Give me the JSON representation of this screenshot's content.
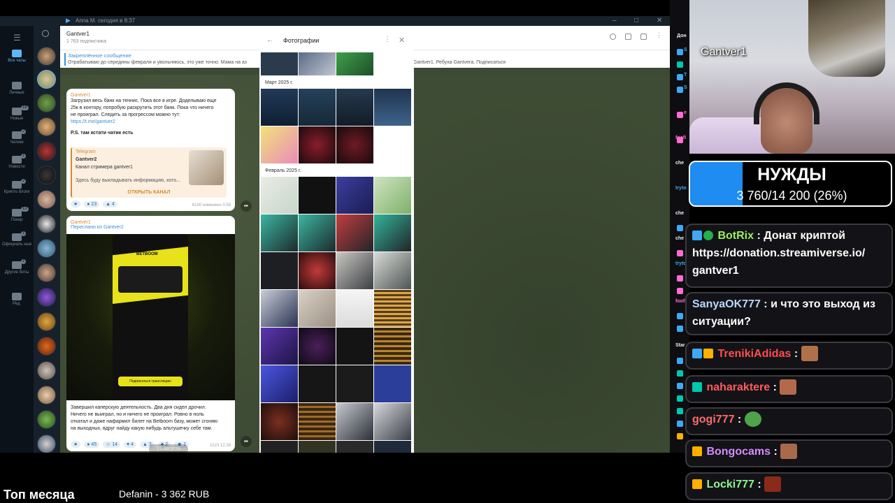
{
  "telegram": {
    "window_title": "Anna M. сегодня в 8:37",
    "folders": [
      {
        "label": "Все чаты",
        "count": "",
        "active": true
      },
      {
        "label": "Личные",
        "count": ""
      },
      {
        "label": "Новые",
        "count": "18"
      },
      {
        "label": "Чатики",
        "count": "2"
      },
      {
        "label": "Новости",
        "count": "1"
      },
      {
        "label": "Крипто блоги",
        "count": "2"
      },
      {
        "label": "Покер",
        "count": "13"
      },
      {
        "label": "Официаль ные",
        "count": "1"
      },
      {
        "label": "Другие боты",
        "count": "1"
      },
      {
        "label": "Ред.",
        "count": ""
      }
    ],
    "chat": {
      "name": "Gantver1",
      "subscribers": "1 763 подписчика",
      "pinned_title": "Закреплённое сообщение",
      "pinned_text": "Отрабатываю до середины февраля и увольняюсь, это уже точно. Мама на аз",
      "pinned_text_tail": "Gantver1. Ребуха Gantvera. Подписаться",
      "post1": {
        "author": "Gantver1",
        "lines": [
          "Загрузил весь банк на теннис. Пока все в игре. Доделываю еще",
          "25к в контору, попробую раскрутить этот банк. Пока что ничего",
          "не проиграл. Следить за прогрессом можно тут:"
        ],
        "link": "https://t.me/gantver2",
        "ps": "P.S. там кстати чатик есть",
        "quote_source": "Telegram",
        "quote_name": "Gantver2",
        "quote_desc": "Канал стримера gantver1",
        "quote_text": "Здесь буду выкладывать информацию, кото...",
        "quote_button": "ОТКРЫТЬ КАНАЛ",
        "reactions": [
          "23",
          "4"
        ],
        "meta": "6150  изменено 0:59"
      },
      "post2": {
        "author": "Gantver1",
        "forwarded": "Переслано из",
        "forwarded_from": "Gantver2",
        "image_logo": "BETBOOM",
        "image_cta": "Подписаться трансляцию",
        "lines": [
          "Завершил каперскую деятельность. Два дня сидел дрочил.",
          "Ничего не выиграл, но и ничего не проиграл. Ровно в ноль",
          "откатал и даже нафармил билет на Betboom базу, может сгоняю",
          "на выходных, вдруг найду какую нибудь альтушечку себе там."
        ],
        "reactions": [
          "45",
          "14",
          "4",
          "3",
          "2",
          "1"
        ],
        "meta": "1023  12:28"
      },
      "date_chip": "21 августа"
    },
    "photos_dialog": {
      "title": "Фотографии",
      "back_icon": "arrow-left-icon",
      "more_icon": "more-vertical-icon",
      "close_icon": "close-icon",
      "sections": [
        "Март 2025 г.",
        "Февраль 2025 г."
      ]
    }
  },
  "stream": {
    "streamer_name": "Gantver1",
    "needs_title": "НУЖДЫ",
    "needs_value": "3 760/14 200 (26%)",
    "needs_progress": 0.26,
    "left_rail_labels": [
      "Дон",
      "S",
      "T",
      "S",
      "e",
      "foofi",
      "che",
      "tryto",
      "che",
      "che",
      "tryto",
      "foofi",
      "Star"
    ],
    "chat_messages": [
      {
        "user": "BotRix",
        "user_color": "#9bf05a",
        "text": "Донат криптой https://donation.streamiverse.io/ gantver1",
        "badges": [
          "prime",
          "verified"
        ]
      },
      {
        "user": "SanyaOK777",
        "user_color": "#b7d7ff",
        "text": "и что это выход из ситуации?",
        "badges": []
      },
      {
        "user": "TrenikiAdidas",
        "user_color": "#ff4d4d",
        "text": "",
        "badges": [
          "prime",
          "crown"
        ]
      },
      {
        "user": "naharaktere",
        "user_color": "#ff5b5b",
        "text": "",
        "badges": [
          "vip"
        ]
      },
      {
        "user": "gogi777",
        "user_color": "#ff6b6b",
        "text": "",
        "badges": []
      },
      {
        "user": "Bongocams",
        "user_color": "#d48bff",
        "text": "",
        "badges": [
          "crown"
        ]
      },
      {
        "user": "Locki777",
        "user_color": "#8df58d",
        "text": "",
        "badges": [
          "crown"
        ]
      }
    ],
    "bottom": {
      "top_month_label": "Топ месяца",
      "top_donor": "Defanin - 3 362 RUB"
    }
  }
}
